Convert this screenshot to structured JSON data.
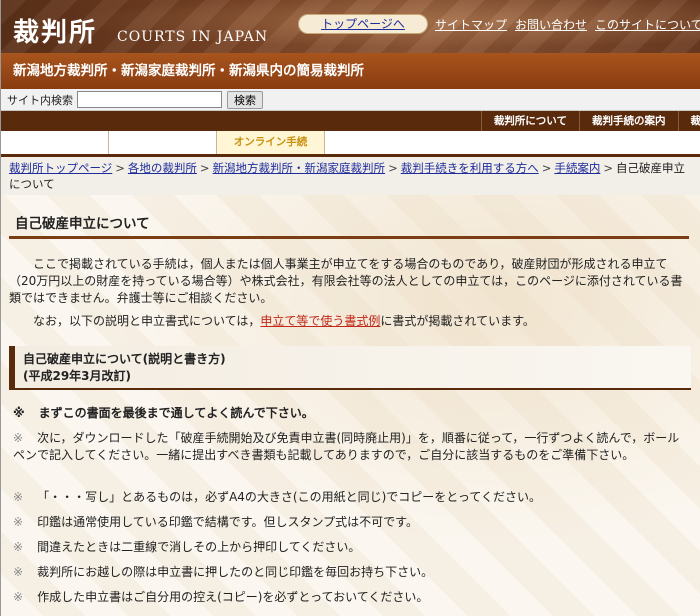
{
  "header": {
    "logo_kanji": "裁判所",
    "logo_en": "COURTS IN JAPAN",
    "top_page_label": "トップページへ",
    "links": [
      "サイトマップ",
      "お問い合わせ",
      "このサイトについて"
    ]
  },
  "banner": {
    "title": "新潟地方裁判所・新潟家庭裁判所・新潟県内の簡易裁判所"
  },
  "search": {
    "label": "サイト内検索",
    "value": "",
    "placeholder": "",
    "button": "検索"
  },
  "gnav": {
    "items": [
      "裁判所について",
      "裁判手続の案内",
      "裁"
    ]
  },
  "subnav": {
    "online": "オンライン手続"
  },
  "breadcrumb": {
    "items": [
      "裁判所トップページ",
      "各地の裁判所",
      "新潟地方裁判所・新潟家庭裁判所",
      "裁判手続きを利用する方へ",
      "手続案内"
    ],
    "current": "自己破産申立について",
    "sep": ">"
  },
  "main": {
    "title": "自己破産申立について",
    "para1": "ここで掲載されている手続は，個人または個人事業主が申立てをする場合のものであり，破産財団が形成される申立て（20万円以上の財産を持っている場合等）や株式会社，有限会社等の法人としての申立ては，このページに添付されている書類ではできません。弁護士等にご相談ください。",
    "para2_before": "なお，以下の説明と申立書式については，",
    "para2_link": "申立て等で使う書式例",
    "para2_after": "に書式が掲載されています。",
    "section_line1": "自己破産申立について(説明と書き方)",
    "section_line2": "(平成29年3月改訂)",
    "mark": "※",
    "items": [
      "まずこの書面を最後まで通してよく読んで下さい。",
      "次に，ダウンロードした「破産手続開始及び免責申立書(同時廃止用)」を，順番に従って，一行ずつよく読んで，ボールペンで記入してください。一緒に提出すべき書類も記載してありますので，ご自分に該当するものをご準備下さい。",
      "「・・・写し」とあるものは，必ずA4の大きさ(この用紙と同じ)でコピーをとってください。",
      "印鑑は通常使用している印鑑で結構です。但しスタンプ式は不可です。",
      "間違えたときは二重線で消しその上から押印してください。",
      "裁判所にお越しの際は申立書に押したのと同じ印鑑を毎回お持ち下さい。",
      "作成した申立書はご自分用の控え(コピー)を必ずとっておいてください。"
    ]
  }
}
